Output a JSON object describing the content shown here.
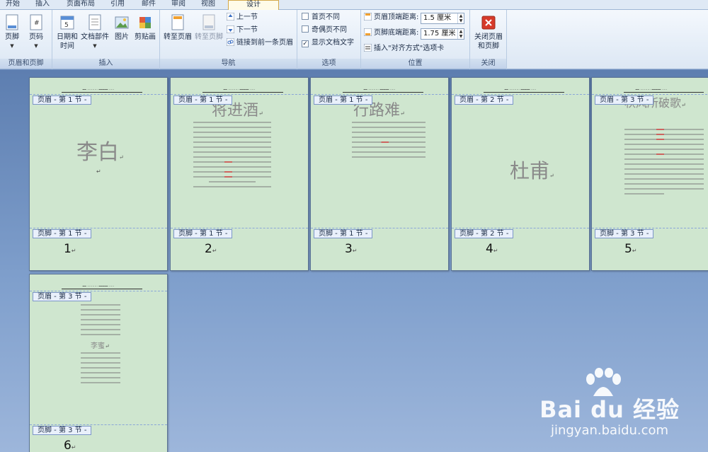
{
  "tabs": [
    "开始",
    "插入",
    "页面布局",
    "引用",
    "邮件",
    "审阅",
    "视图",
    "设计"
  ],
  "ribbon": {
    "groups": {
      "header_footer": "页眉和页脚",
      "insert": "插入",
      "nav": "导航",
      "options": "选项",
      "position": "位置",
      "close": "关闭"
    },
    "footer_btn": "页脚",
    "page_num_btn": "页码",
    "datetime_btn": "日期和时间",
    "quickparts_btn": "文档部件",
    "picture_btn": "图片",
    "clipart_btn": "剪贴画",
    "goto_header": "转至页眉",
    "goto_footer": "转至页脚",
    "prev_section": "上一节",
    "next_section": "下一节",
    "link_prev": "链接到前一条页眉",
    "diff_first": "首页不同",
    "diff_odd_even": "奇偶页不同",
    "show_text": "显示文档文字",
    "header_dist_label": "页眉顶端距离:",
    "header_dist_value": "1.5 厘米",
    "footer_dist_label": "页脚底端距离:",
    "footer_dist_value": "1.75 厘米",
    "align_tab": "插入\"对齐方式\"选项卡",
    "close_btn": "关闭页眉和页脚"
  },
  "pages": [
    {
      "header": "页眉 - 第 1 节 -",
      "footer": "页脚 - 第 1 节 -",
      "title": "李白",
      "num": "1"
    },
    {
      "header": "页眉 - 第 1 节 -",
      "footer": "页脚 - 第 1 节 -",
      "title": "将进酒",
      "num": "2"
    },
    {
      "header": "页眉 - 第 1 节 -",
      "footer": "页脚 - 第 1 节 -",
      "title": "行路难",
      "num": "3"
    },
    {
      "header": "页眉 - 第 2 节 -",
      "footer": "页脚 - 第 2 节 -",
      "title": "杜甫",
      "num": "4"
    },
    {
      "header": "页眉 - 第 3 节 -",
      "footer": "页脚 - 第 3 节 -",
      "title": "秋风所破歌",
      "num": "5"
    },
    {
      "header": "页眉 - 第 3 节 -",
      "footer": "页脚 - 第 3 节 -",
      "title": "李蜜",
      "num": "6"
    }
  ],
  "watermark": {
    "brand": "Bai du 经验",
    "url": "jingyan.baidu.com"
  }
}
